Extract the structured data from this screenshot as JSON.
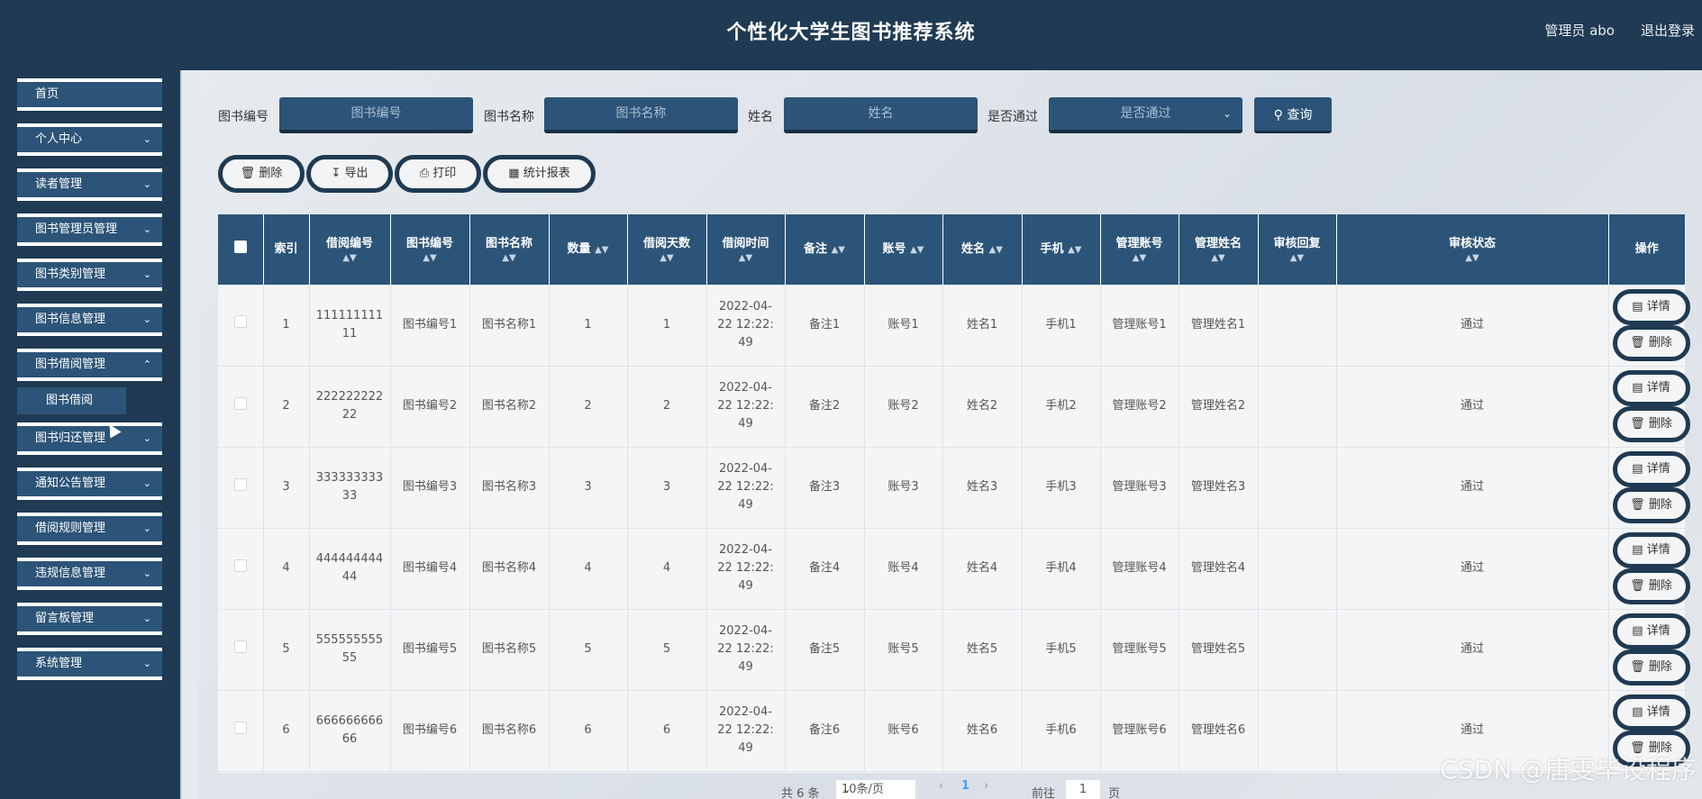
{
  "header": {
    "title": "个性化大学生图书推荐系统",
    "user": "管理员 abo",
    "logout": "退出登录"
  },
  "sidebar": {
    "items": [
      {
        "label": "首页",
        "chevron": false
      },
      {
        "label": "个人中心",
        "chevron": true
      },
      {
        "label": "读者管理",
        "chevron": true
      },
      {
        "label": "图书管理员管理",
        "chevron": true
      },
      {
        "label": "图书类别管理",
        "chevron": true
      },
      {
        "label": "图书信息管理",
        "chevron": true
      },
      {
        "label": "图书借阅管理",
        "chevron": true
      },
      {
        "label": "图书归还管理",
        "chevron": true
      },
      {
        "label": "通知公告管理",
        "chevron": true
      },
      {
        "label": "借阅规则管理",
        "chevron": true
      },
      {
        "label": "违规信息管理",
        "chevron": true
      },
      {
        "label": "留言板管理",
        "chevron": true
      },
      {
        "label": "系统管理",
        "chevron": true
      }
    ],
    "sub_item": "图书借阅"
  },
  "search": {
    "book_no_label": "图书编号",
    "book_no_placeholder": "图书编号",
    "book_name_label": "图书名称",
    "book_name_placeholder": "图书名称",
    "name_label": "姓名",
    "name_placeholder": "姓名",
    "passed_label": "是否通过",
    "passed_placeholder": "是否通过",
    "query_button": "查询"
  },
  "actions": {
    "delete": "删除",
    "export": "导出",
    "print": "打印",
    "stats": "统计报表"
  },
  "table": {
    "headers": {
      "index": "索引",
      "borrow_no": "借阅编号",
      "book_no": "图书编号",
      "book_name": "图书名称",
      "qty": "数量",
      "days": "借阅天数",
      "time": "借阅时间",
      "remark": "备注",
      "account": "账号",
      "name": "姓名",
      "phone": "手机",
      "admin_account": "管理账号",
      "admin_name": "管理姓名",
      "reply": "审核回复",
      "status": "审核状态",
      "ops": "操作"
    },
    "rows": [
      {
        "index": "1",
        "borrow_no_a": "111111111",
        "borrow_no_b": "11",
        "book_no": "图书编号1",
        "book_name": "图书名称1",
        "qty": "1",
        "days": "1",
        "time_a": "2022-04-",
        "time_b": "22 12:22:",
        "time_c": "49",
        "remark": "备注1",
        "account": "账号1",
        "name": "姓名1",
        "phone": "手机1",
        "admin_account": "管理账号1",
        "admin_name": "管理姓名1",
        "reply": "",
        "status": "通过"
      },
      {
        "index": "2",
        "borrow_no_a": "222222222",
        "borrow_no_b": "22",
        "book_no": "图书编号2",
        "book_name": "图书名称2",
        "qty": "2",
        "days": "2",
        "time_a": "2022-04-",
        "time_b": "22 12:22:",
        "time_c": "49",
        "remark": "备注2",
        "account": "账号2",
        "name": "姓名2",
        "phone": "手机2",
        "admin_account": "管理账号2",
        "admin_name": "管理姓名2",
        "reply": "",
        "status": "通过"
      },
      {
        "index": "3",
        "borrow_no_a": "333333333",
        "borrow_no_b": "33",
        "book_no": "图书编号3",
        "book_name": "图书名称3",
        "qty": "3",
        "days": "3",
        "time_a": "2022-04-",
        "time_b": "22 12:22:",
        "time_c": "49",
        "remark": "备注3",
        "account": "账号3",
        "name": "姓名3",
        "phone": "手机3",
        "admin_account": "管理账号3",
        "admin_name": "管理姓名3",
        "reply": "",
        "status": "通过"
      },
      {
        "index": "4",
        "borrow_no_a": "444444444",
        "borrow_no_b": "44",
        "book_no": "图书编号4",
        "book_name": "图书名称4",
        "qty": "4",
        "days": "4",
        "time_a": "2022-04-",
        "time_b": "22 12:22:",
        "time_c": "49",
        "remark": "备注4",
        "account": "账号4",
        "name": "姓名4",
        "phone": "手机4",
        "admin_account": "管理账号4",
        "admin_name": "管理姓名4",
        "reply": "",
        "status": "通过"
      },
      {
        "index": "5",
        "borrow_no_a": "555555555",
        "borrow_no_b": "55",
        "book_no": "图书编号5",
        "book_name": "图书名称5",
        "qty": "5",
        "days": "5",
        "time_a": "2022-04-",
        "time_b": "22 12:22:",
        "time_c": "49",
        "remark": "备注5",
        "account": "账号5",
        "name": "姓名5",
        "phone": "手机5",
        "admin_account": "管理账号5",
        "admin_name": "管理姓名5",
        "reply": "",
        "status": "通过"
      },
      {
        "index": "6",
        "borrow_no_a": "666666666",
        "borrow_no_b": "66",
        "book_no": "图书编号6",
        "book_name": "图书名称6",
        "qty": "6",
        "days": "6",
        "time_a": "2022-04-",
        "time_b": "22 12:22:",
        "time_c": "49",
        "remark": "备注6",
        "account": "账号6",
        "name": "姓名6",
        "phone": "手机6",
        "admin_account": "管理账号6",
        "admin_name": "管理姓名6",
        "reply": "",
        "status": "通过"
      }
    ],
    "row_detail_button": "详情",
    "row_delete_button": "删除"
  },
  "pagination": {
    "total": "共 6 条",
    "page_size": "10条/页",
    "current_page": "1",
    "goto_label": "前往",
    "goto_value": "1",
    "page_suffix": "页"
  },
  "watermark": "CSDN @唐雯毕设程序",
  "colors": {
    "nav_bg": "#1f3a52",
    "accent": "#2c5478",
    "table_header": "#2c5478",
    "pager_active": "#409eff"
  }
}
